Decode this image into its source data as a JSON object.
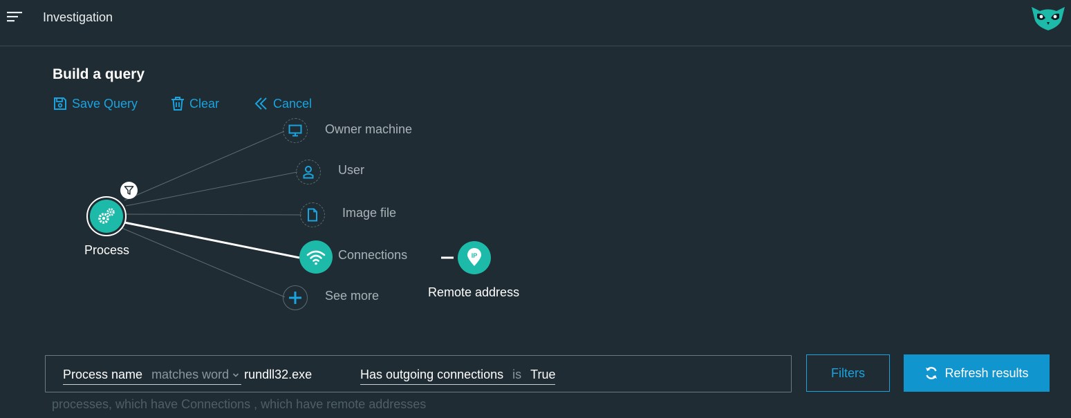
{
  "header": {
    "title": "Investigation",
    "menu_icon": "hamburger-menu-icon",
    "logo_icon": "owl-logo-icon"
  },
  "page": {
    "title": "Build a query"
  },
  "actions": {
    "save_label": "Save Query",
    "clear_label": "Clear",
    "cancel_label": "Cancel"
  },
  "graph": {
    "root": {
      "label": "Process",
      "icon": "gears-icon",
      "badge_icon": "filter-icon"
    },
    "options": [
      {
        "label": "Owner machine",
        "icon": "monitor-icon"
      },
      {
        "label": "User",
        "icon": "user-icon"
      },
      {
        "label": "Image file",
        "icon": "file-icon"
      },
      {
        "label": "Connections",
        "icon": "wifi-icon"
      },
      {
        "label": "See more",
        "icon": "plus-icon"
      }
    ],
    "child": {
      "label": "Remote address",
      "icon": "ip-pin-icon"
    }
  },
  "query": {
    "conditions": [
      {
        "field": "Process name",
        "operator": "matches word",
        "value": "rundll32.exe"
      },
      {
        "field": "Has outgoing connections",
        "operator": "is",
        "value": "True"
      }
    ],
    "summary": "processes, which have Connections , which have remote addresses"
  },
  "buttons": {
    "filters_label": "Filters",
    "refresh_label": "Refresh results"
  },
  "colors": {
    "background": "#1f2c33",
    "accent_blue": "#1aa3df",
    "teal": "#1ebaa9",
    "primary_button": "#1195cf"
  }
}
